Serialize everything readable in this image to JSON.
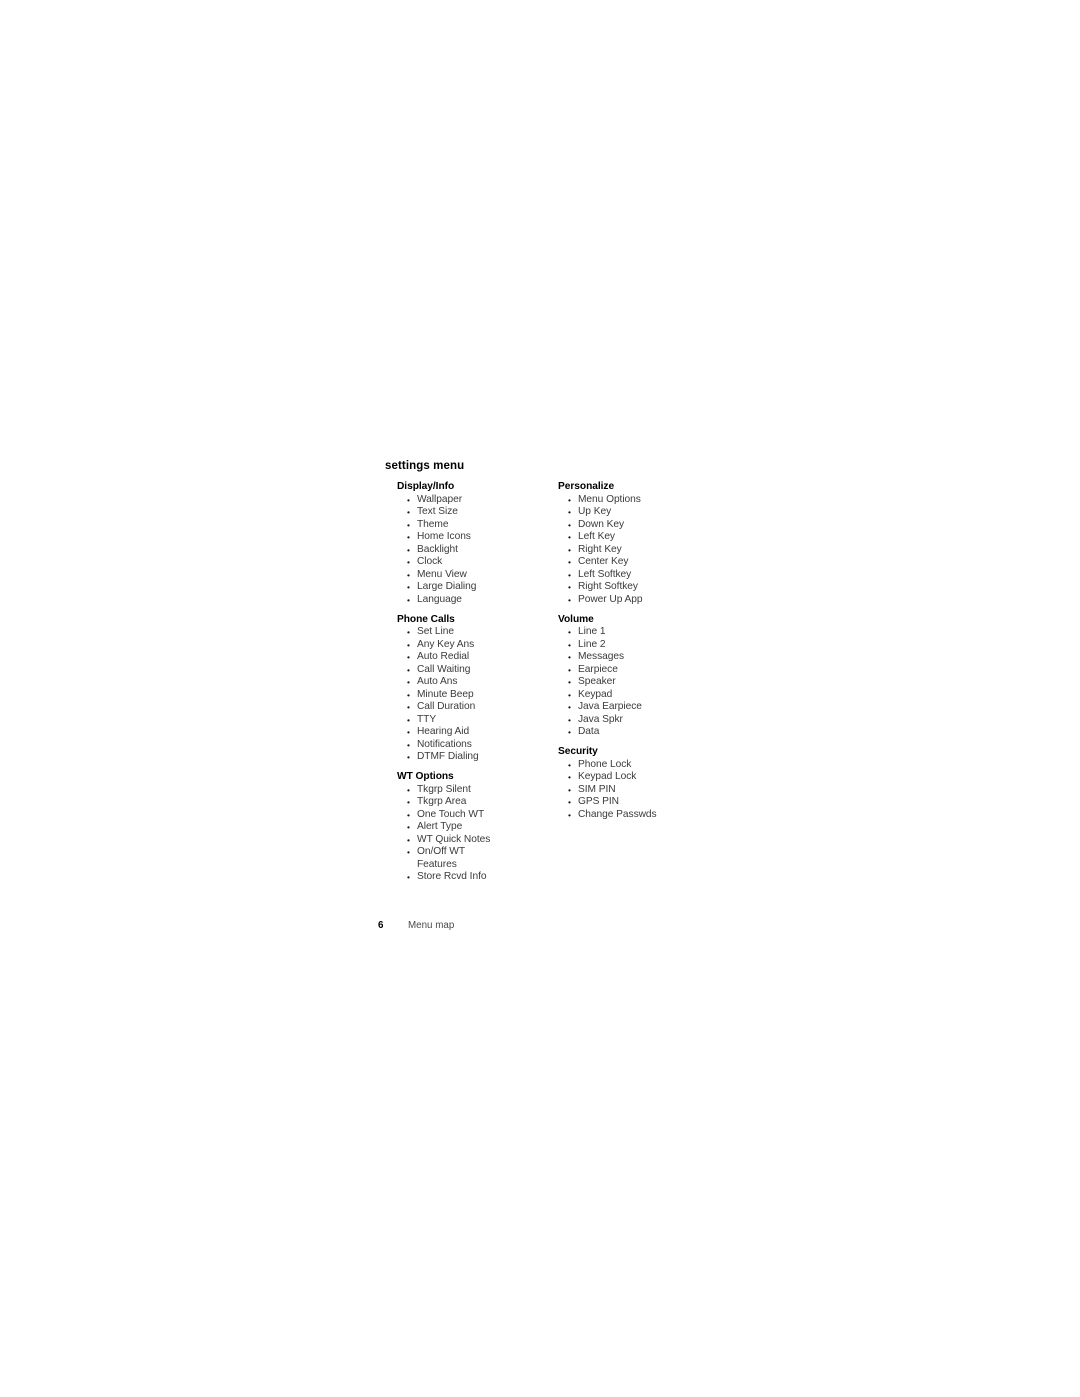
{
  "document": {
    "chapter_title": "settings menu"
  },
  "columns": {
    "left": [
      {
        "title": "Display/Info",
        "items": [
          "Wallpaper",
          "Text Size",
          "Theme",
          "Home Icons",
          "Backlight",
          "Clock",
          "Menu View",
          "Large Dialing",
          "Language"
        ]
      },
      {
        "title": "Phone Calls",
        "items": [
          "Set Line",
          "Any Key Ans",
          "Auto Redial",
          "Call Waiting",
          "Auto Ans",
          "Minute Beep",
          "Call Duration",
          "TTY",
          "Hearing Aid",
          "Notifications",
          "DTMF Dialing"
        ]
      },
      {
        "title": "WT Options",
        "items": [
          "Tkgrp Silent",
          "Tkgrp Area",
          "One Touch WT",
          "Alert Type",
          "WT Quick Notes",
          "On/Off WT\nFeatures",
          "Store Rcvd Info"
        ]
      }
    ],
    "right": [
      {
        "title": "Personalize",
        "items": [
          "Menu Options",
          "Up Key",
          "Down Key",
          "Left Key",
          "Right Key",
          "Center Key",
          "Left Softkey",
          "Right Softkey",
          "Power Up App"
        ]
      },
      {
        "title": "Volume",
        "items": [
          "Line 1",
          "Line 2",
          "Messages",
          "Earpiece",
          "Speaker",
          "Keypad",
          "Java Earpiece",
          "Java Spkr",
          "Data"
        ]
      },
      {
        "title": "Security",
        "items": [
          "Phone Lock",
          "Keypad Lock",
          "SIM PIN",
          "GPS PIN",
          "Change Passwds"
        ]
      }
    ]
  },
  "footer": {
    "page_number": "6",
    "label": "Menu map"
  }
}
